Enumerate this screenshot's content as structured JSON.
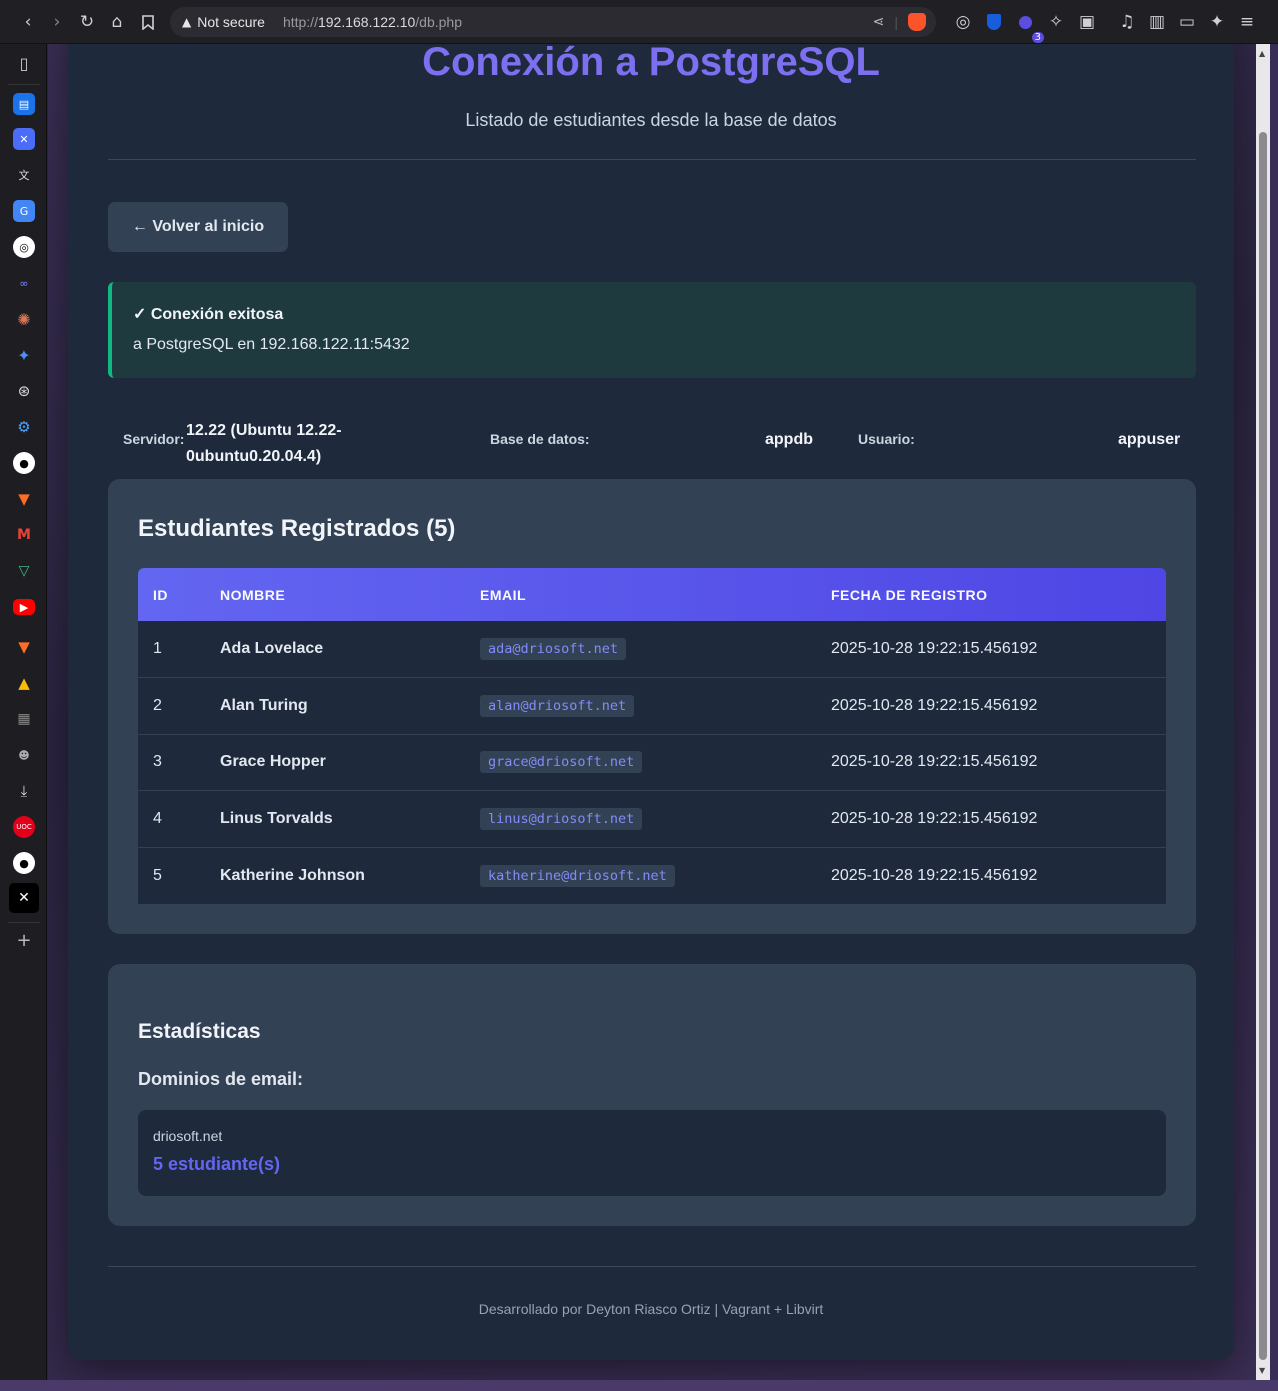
{
  "browser": {
    "security_label": "Not secure",
    "url_prefix": "http://",
    "url_host": "192.168.122.10",
    "url_path": "/db.php",
    "extension_badge": "3"
  },
  "page": {
    "title": "Conexión a PostgreSQL",
    "subtitle": "Listado de estudiantes desde la base de datos",
    "back_button": "← Volver al inicio",
    "alert": {
      "title": "✓ Conexión exitosa",
      "detail": "a PostgreSQL en 192.168.122.11:5432",
      "accent_color": "#10b981"
    },
    "info": {
      "server_label": "Servidor:",
      "server_value_line1": "12.22 (Ubuntu 12.22-",
      "server_value_line2": "0ubuntu0.20.04.4)",
      "db_label": "Base de datos:",
      "db_value": "appdb",
      "user_label": "Usuario:",
      "user_value": "appuser"
    },
    "students_card": {
      "title": "Estudiantes Registrados (5)",
      "columns": [
        "ID",
        "NOMBRE",
        "EMAIL",
        "FECHA DE REGISTRO"
      ],
      "rows": [
        {
          "id": "1",
          "name": "Ada Lovelace",
          "email": "ada@driosoft.net",
          "date": "2025-10-28 19:22:15.456192"
        },
        {
          "id": "2",
          "name": "Alan Turing",
          "email": "alan@driosoft.net",
          "date": "2025-10-28 19:22:15.456192"
        },
        {
          "id": "3",
          "name": "Grace Hopper",
          "email": "grace@driosoft.net",
          "date": "2025-10-28 19:22:15.456192"
        },
        {
          "id": "4",
          "name": "Linus Torvalds",
          "email": "linus@driosoft.net",
          "date": "2025-10-28 19:22:15.456192"
        },
        {
          "id": "5",
          "name": "Katherine Johnson",
          "email": "katherine@driosoft.net",
          "date": "2025-10-28 19:22:15.456192"
        }
      ],
      "header_color": "#6366f1"
    },
    "stats_card": {
      "title": "Estadísticas",
      "subtitle": "Dominios de email:",
      "domain": "driosoft.net",
      "count": "5 estudiante(s)"
    },
    "footer": "Desarrollado por Deyton Riasco Ortiz | Vagrant + Libvirt"
  },
  "icons": {
    "toolbar": [
      "back-icon",
      "forward-icon",
      "reload-icon",
      "home-icon",
      "bookmark-icon",
      "warning-icon",
      "share-icon",
      "brave-shields-icon",
      "extensions-icon",
      "music-icon",
      "sidebar-toggle-icon",
      "wallet-icon",
      "leo-icon",
      "menu-icon"
    ],
    "sidebar": [
      "sidebar-panel-icon",
      "calendar-icon",
      "app-icon",
      "translate-icon",
      "google-translate-icon",
      "openai-icon",
      "app2-icon",
      "claude-icon",
      "gemini-icon",
      "chatgpt-icon",
      "gear-icon",
      "github-icon",
      "gitlab-icon",
      "gmail-icon",
      "vue-icon",
      "youtube-icon",
      "gitlab2-icon",
      "drive-icon",
      "apps-icon",
      "mascot-icon",
      "download-icon",
      "uoc-icon",
      "github2-icon",
      "x-icon",
      "add-icon"
    ]
  }
}
